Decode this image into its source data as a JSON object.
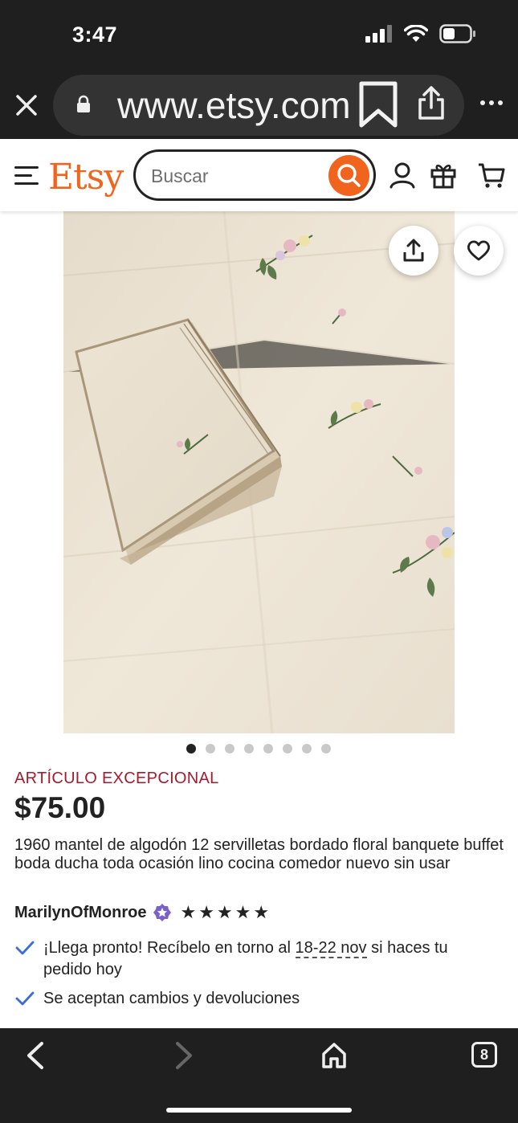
{
  "status_bar": {
    "time": "3:47",
    "icons": [
      "signal-icon",
      "wifi-icon",
      "battery-icon"
    ]
  },
  "browser": {
    "url": "www.etsy.com",
    "icons": [
      "close-icon",
      "lock-icon",
      "bookmark-icon",
      "share-icon",
      "more-icon"
    ]
  },
  "header": {
    "logo": "Etsy",
    "search_placeholder": "Buscar",
    "icons": [
      "menu-icon",
      "search-icon",
      "account-icon",
      "gift-icon",
      "cart-icon"
    ]
  },
  "listing": {
    "image_alt": "Mantel bordado con servilletas",
    "carousel": {
      "count": 8,
      "active_index": 0
    },
    "badge": "ARTÍCULO EXCEPCIONAL",
    "price": "$75.00",
    "title": "1960 mantel de algodón 12 servilletas bordado floral banquete buffet boda ducha toda ocasión lino cocina comedor nuevo sin usar",
    "shop_name": "MarilynOfMonroe",
    "rating_stars": 5,
    "perks": [
      {
        "text_before": "¡Llega pronto! Recíbelo en torno al ",
        "date": "18-22 nov",
        "text_after": " si haces tu pedido hoy"
      },
      {
        "text": "Se aceptan cambios y devoluciones"
      }
    ]
  },
  "toolbar": {
    "tab_count": "8",
    "icons": [
      "back-icon",
      "forward-icon",
      "home-icon",
      "tabs-icon"
    ]
  },
  "colors": {
    "etsy_orange": "#f1641e",
    "badge_red": "#a61a2e",
    "check_blue": "#3b6dd8",
    "chrome_dark": "#1f1f1f"
  }
}
